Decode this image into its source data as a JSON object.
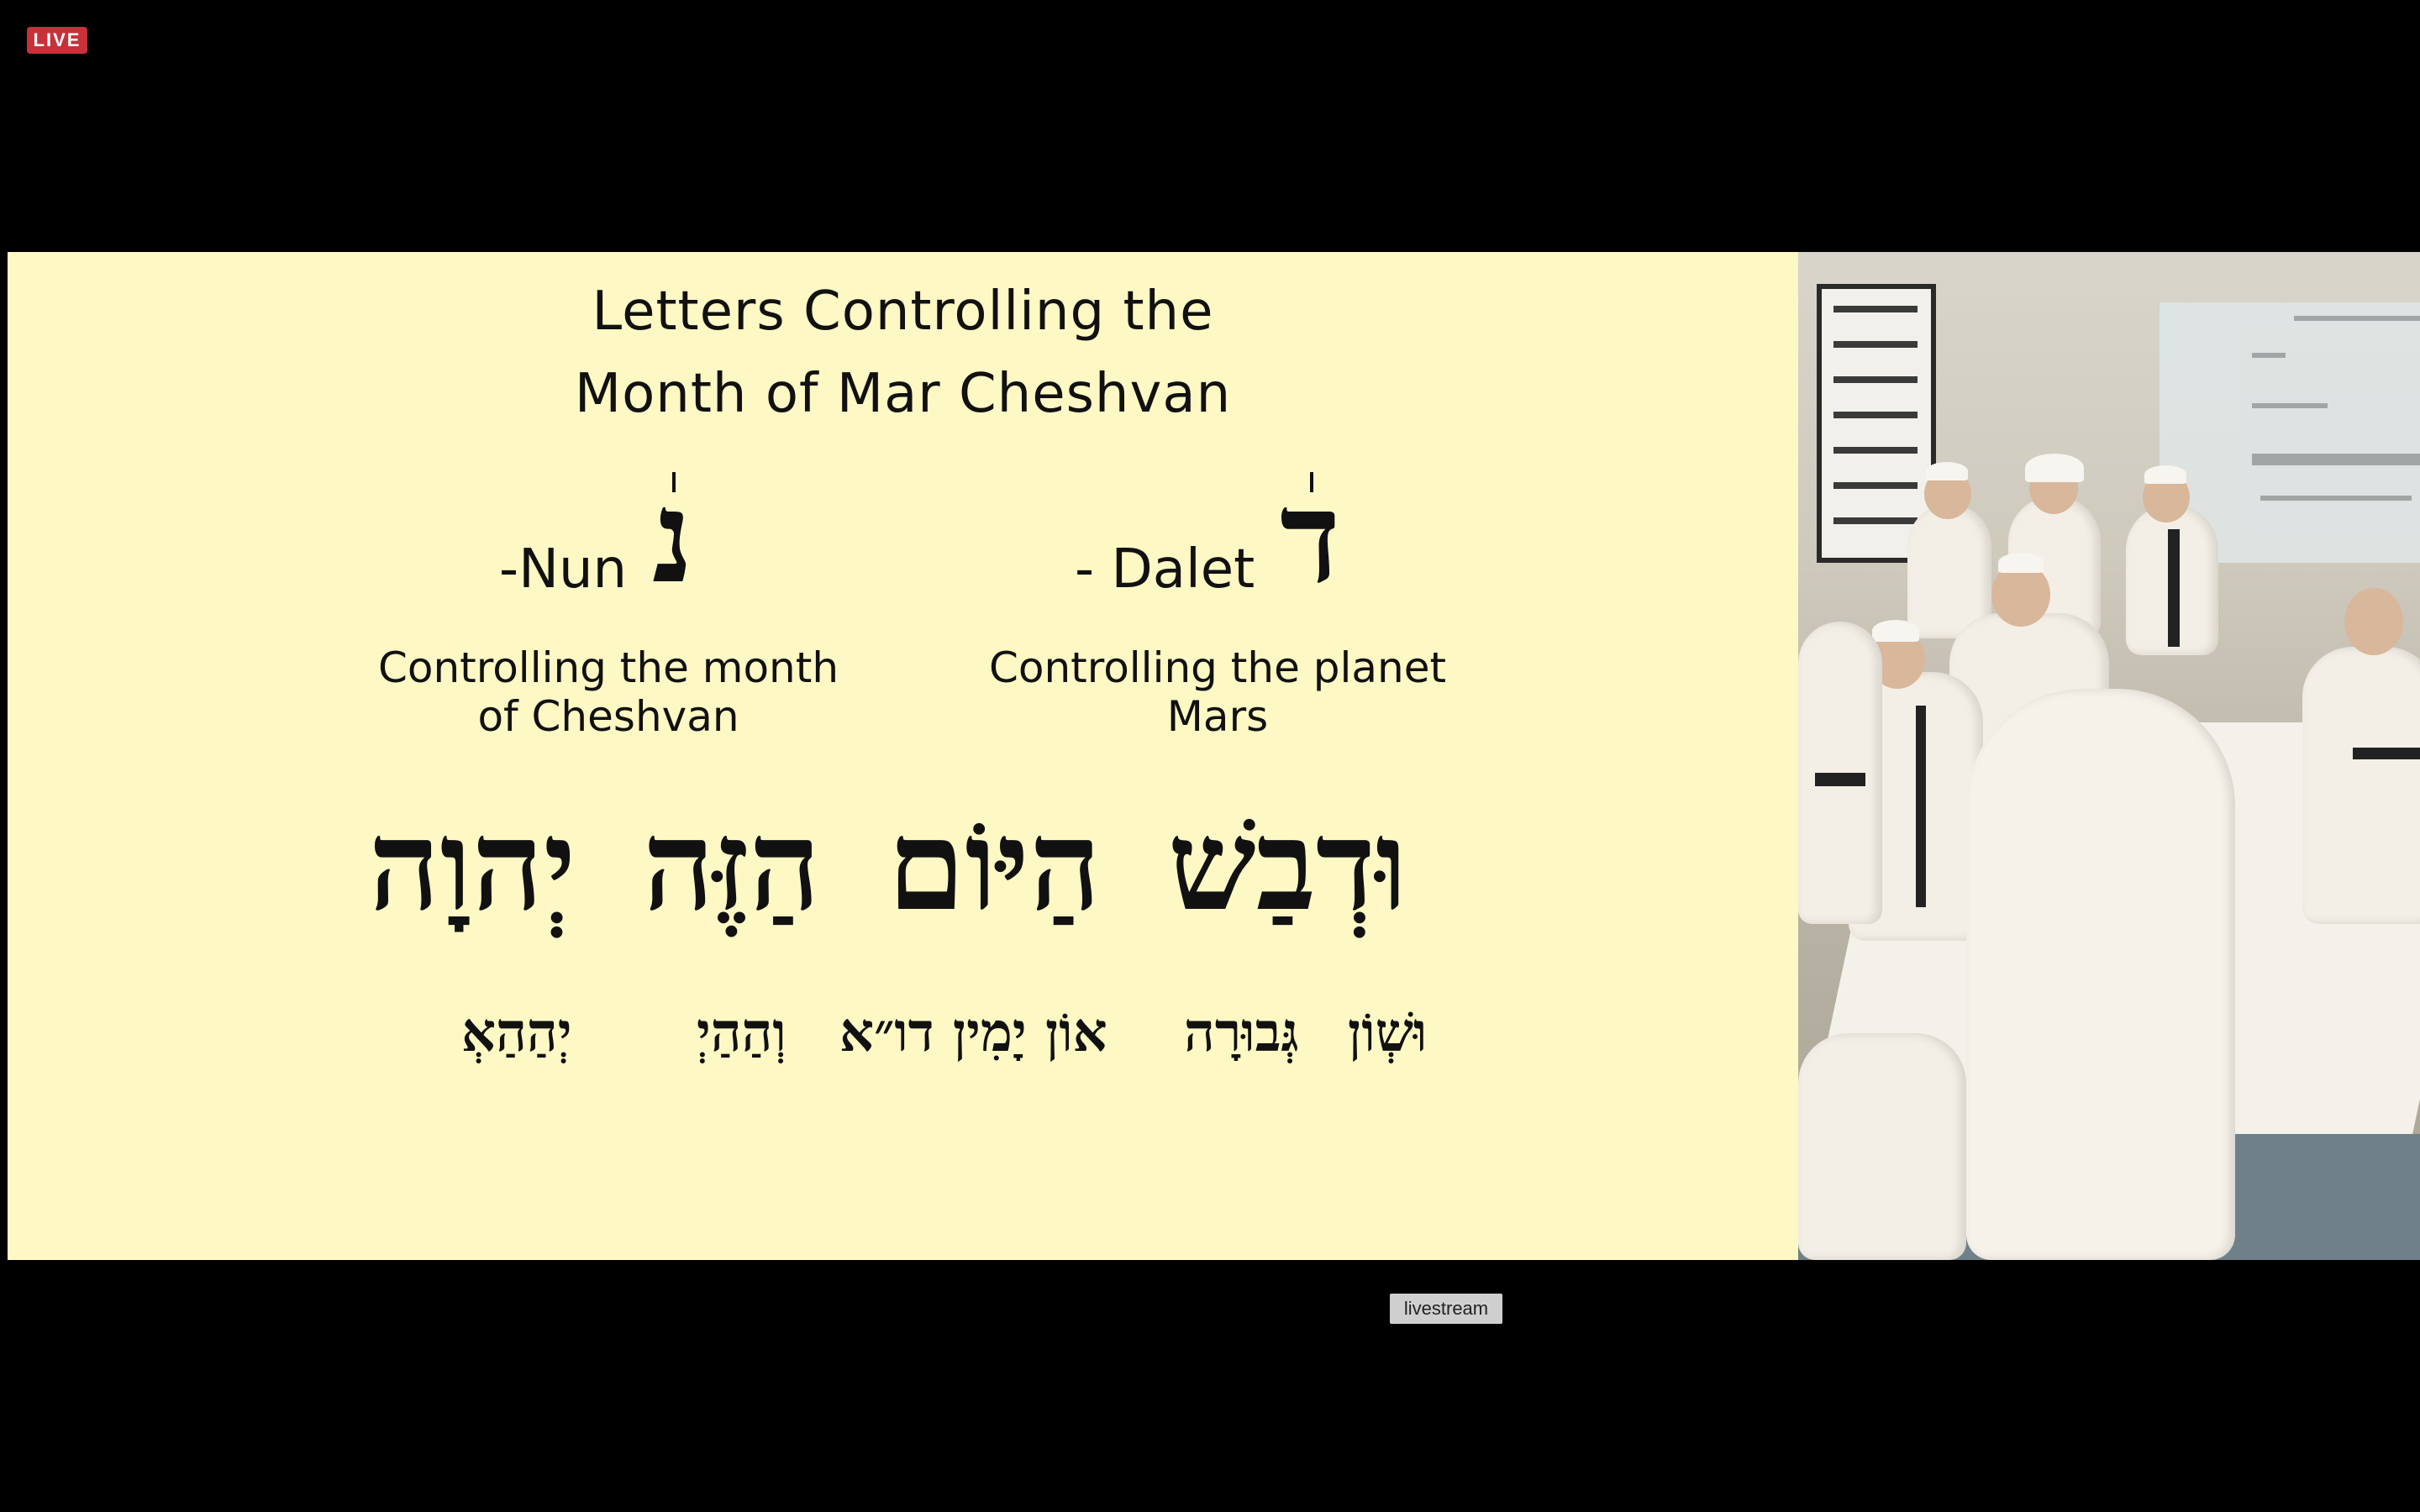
{
  "live_badge": "LIVE",
  "slide": {
    "title_line1": "Letters Controlling the",
    "title_line2": "Month of Mar Cheshvan",
    "letter_left": {
      "name": "-Nun",
      "hebrew": "נ"
    },
    "letter_right": {
      "name": "- Dalet",
      "hebrew": "ד"
    },
    "desc_left_line1": "Controlling the month",
    "desc_left_line2": "of Cheshvan",
    "desc_right_line1": "Controlling the planet",
    "desc_right_line2": "Mars",
    "verse_words": [
      "וּדְבַשׁ",
      "הַיּוֹם",
      "הַזֶּה",
      "יְהוָה"
    ],
    "sub_left": "יְהַהַאְ",
    "sub_mid": "וְהַהַיְ",
    "sub_center": "אוֹן יָמִין דו״א",
    "sub_right1": "גְּבוּרָה",
    "sub_right2": "וּשְׁוֹן"
  },
  "livestream_label": "livestream"
}
